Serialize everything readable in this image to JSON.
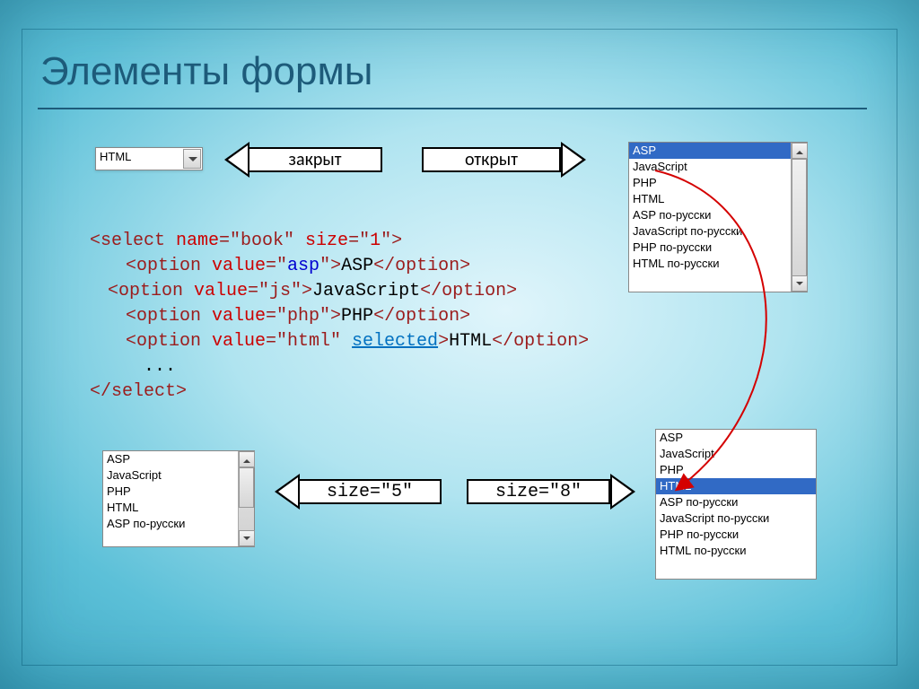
{
  "title": "Элементы формы",
  "arrow_closed": "закрыт",
  "arrow_open": "открыт",
  "arrow_size5": "size=\"5\"",
  "arrow_size8": "size=\"8\"",
  "closed_select_value": "HTML",
  "code": {
    "l1a": "<select ",
    "l1b": "name",
    "l1c": "=\"book\" ",
    "l1d": "size",
    "l1e": "=\"",
    "l1f": "1",
    "l1g": "\">",
    "l2a": "<option ",
    "l2b": "value",
    "l2c": "=\"",
    "l2d": "asp",
    "l2e": "\">",
    "l2f": "ASP",
    "l2g": "</option>",
    "l3a": "<option ",
    "l3b": "value",
    "l3c": "=\"js\">",
    "l3d": "JavaScript",
    "l3e": "</option>",
    "l4a": "<option ",
    "l4b": "value",
    "l4c": "=\"php\">",
    "l4d": "PHP",
    "l4e": "</option>",
    "l5a": "<option ",
    "l5b": "value",
    "l5c": "=\"html\" ",
    "l5d": "selected",
    "l5e": ">",
    "l5f": "HTML",
    "l5g": "</option>",
    "l6": "...",
    "l7": "</select>"
  },
  "open_list": [
    "ASP",
    "JavaScript",
    "PHP",
    "HTML",
    "ASP по-русски",
    "JavaScript по-русски",
    "PHP по-русски",
    "HTML по-русски"
  ],
  "open_selected": "ASP",
  "size5_list": [
    "ASP",
    "JavaScript",
    "PHP",
    "HTML",
    "ASP по-русски"
  ],
  "size8_list": [
    "ASP",
    "JavaScript",
    "PHP",
    "HTML",
    "ASP по-русски",
    "JavaScript по-русски",
    "PHP по-русски",
    "HTML по-русски"
  ],
  "size8_selected": "HTML"
}
